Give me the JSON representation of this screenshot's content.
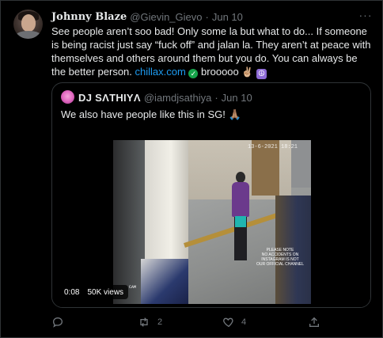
{
  "author": {
    "name": "Johnny Blaze",
    "handle": "@Gievin_Gievo",
    "dot": "·",
    "date": "Jun 10"
  },
  "tweet": {
    "line1": "See people aren’t soo bad! Only some la but what to do... If someone is being racist just say “fuck off” and jalan la. They aren’t at peace with themselves and others around them but you do. You can always be the better person. ",
    "link": "chillax.com",
    "after_link": " brooooo ",
    "hand_emoji": "✌🏼"
  },
  "quote": {
    "name": "DJ SΛTHIYΛ",
    "handle": "@iamdjsathiya",
    "dot": "·",
    "date": "Jun 10",
    "text": "We also have people like this in SG! 🙏🏽"
  },
  "video": {
    "duration": "0:08",
    "views": "50K views",
    "cctv_timestamp": "13-6-2021 18:21",
    "cctv_note": "PLEASE NOTE\nNO ACCIDENTS ON\nINSTAGRAM IS NOT\nOUR OFFICIAL CHANNEL",
    "cctv_cam": "CAM"
  },
  "actions": {
    "reply_count": "",
    "retweet_count": "2",
    "like_count": "4"
  },
  "colors": {
    "link": "#1d9bf0",
    "muted": "#71767b",
    "border": "#2f3336"
  }
}
